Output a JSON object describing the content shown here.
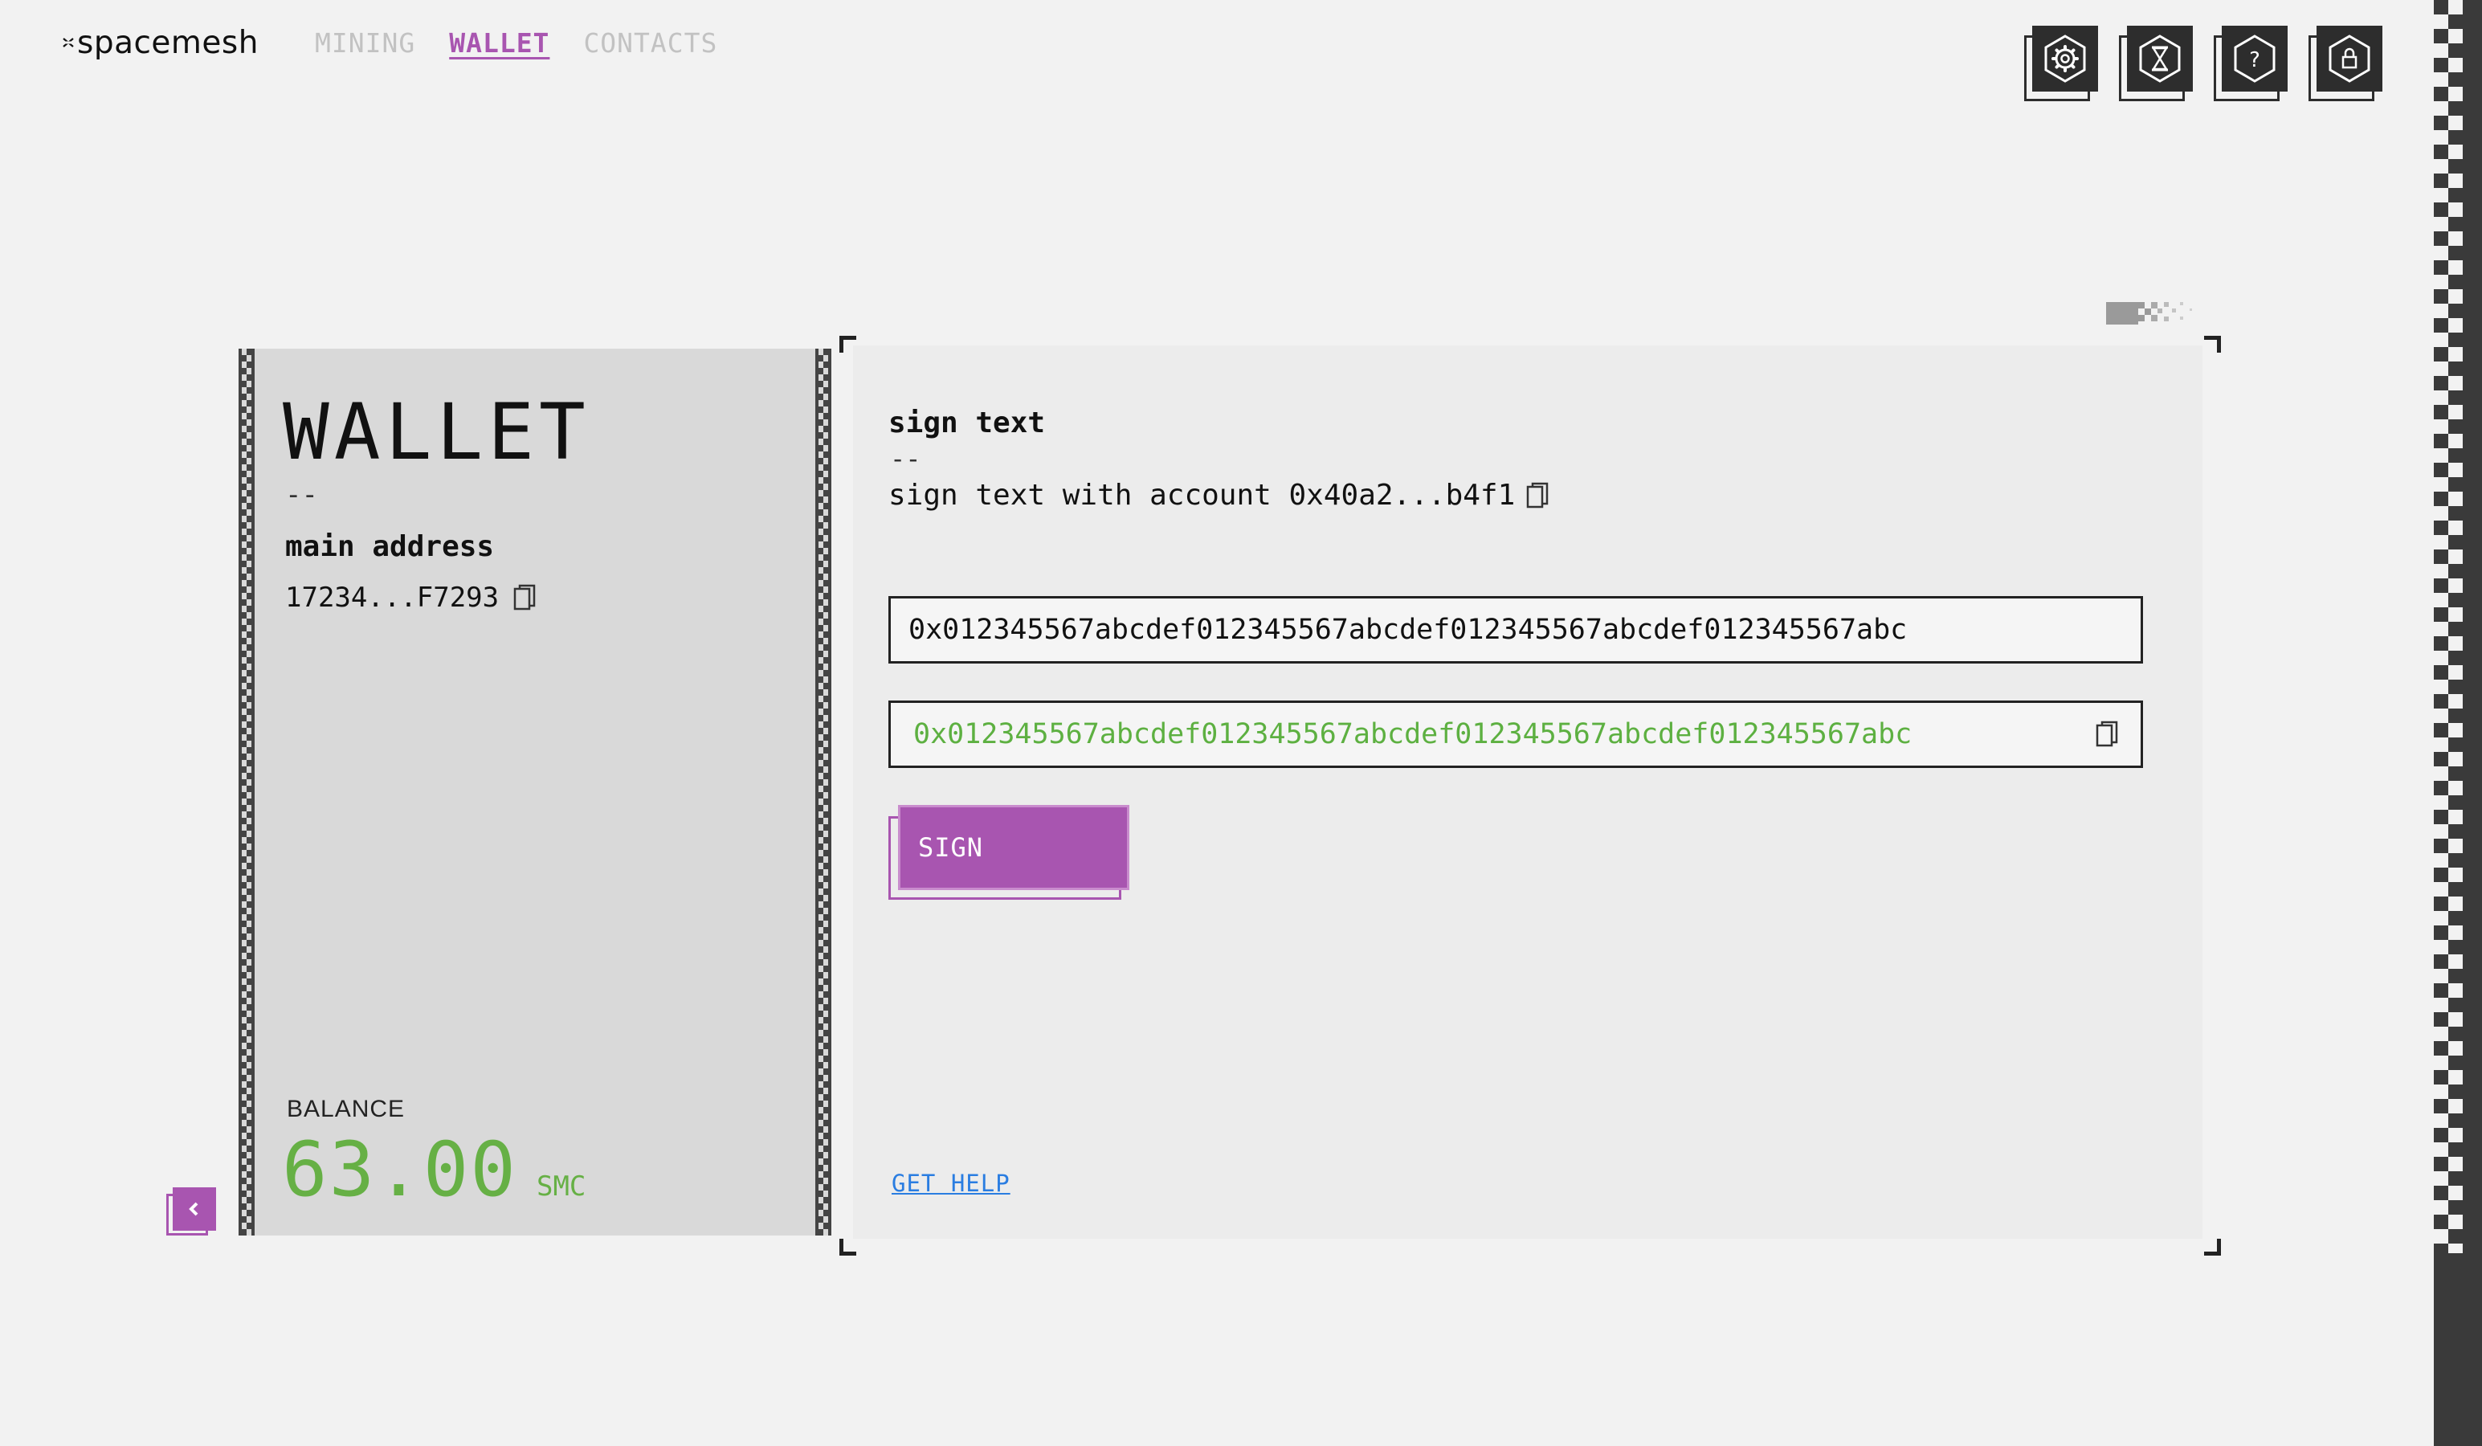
{
  "app": {
    "name": "spacemesh"
  },
  "nav": {
    "items": [
      {
        "label": "MINING",
        "active": false
      },
      {
        "label": "WALLET",
        "active": true
      },
      {
        "label": "CONTACTS",
        "active": false
      }
    ]
  },
  "toolbar": {
    "icons": [
      "settings-icon",
      "hourglass-icon",
      "help-icon",
      "lock-icon"
    ]
  },
  "wallet": {
    "title": "WALLET",
    "separator": "--",
    "main_address_label": "main address",
    "main_address": "17234...F7293",
    "balance_label": "BALANCE",
    "balance_value": "63.00",
    "balance_unit": "SMC"
  },
  "sign": {
    "title": "sign text",
    "separator": "--",
    "subtitle": "sign text with account 0x40a2...b4f1",
    "input_value": "0x012345567abcdef012345567abcdef012345567abcdef012345567abc",
    "output_value": "0x012345567abcdef012345567abcdef012345567abcdef012345567abc",
    "button_label": "SIGN",
    "help_link": "GET HELP"
  },
  "colors": {
    "accent": "#a855b0",
    "balance": "#66b045",
    "output": "#5db041",
    "link": "#2a7de1",
    "dark": "#2d2d2d",
    "background": "#f2f2f2"
  }
}
